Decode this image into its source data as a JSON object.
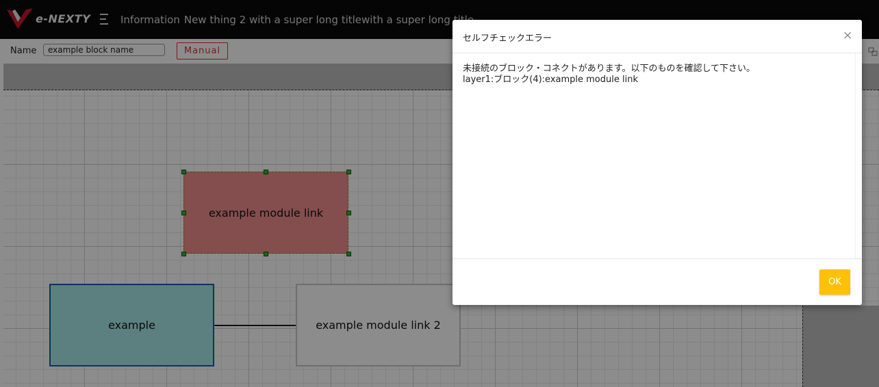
{
  "header": {
    "logo_text": "e-NEXTY",
    "info_label": "Information",
    "info_title": "New thing 2 with a super long titlewith a super long title"
  },
  "namebar": {
    "name_label": "Name",
    "name_value": "example block name",
    "manual_label": "Manual"
  },
  "canvas": {
    "blocks": [
      {
        "label": "example module link",
        "fill": "#f08f8f",
        "selected": true
      },
      {
        "label": "example",
        "fill": "#a6eae8",
        "selected": false
      },
      {
        "label": "example module link 2",
        "fill": "#ffffff",
        "selected": false
      }
    ]
  },
  "modal": {
    "title": "セルフチェックエラー",
    "close_symbol": "×",
    "message_lines": [
      "未接続のブロック・コネクトがあります。以下のものを確認して下さい。",
      "layer1:ブロック(4):example module link"
    ],
    "ok_label": "OK"
  },
  "colors": {
    "topbar": "#0a0a0a",
    "manual_accent": "#e03030",
    "ok_button": "#ffc107",
    "selection_handle": "#2fb82f"
  }
}
